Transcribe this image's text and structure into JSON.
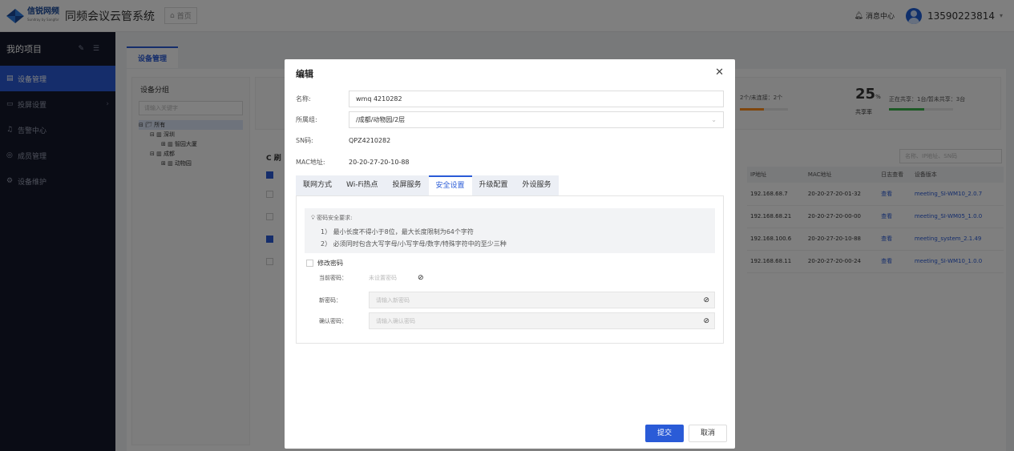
{
  "colors": {
    "primary": "#2a5bd7",
    "sidebar_bg": "#14182a",
    "overlay": "rgba(0,0,0,0.5)"
  },
  "header": {
    "brand_name": "信锐网频",
    "brand_sub": "Sundray by Sangfor",
    "app_title": "同频会议云管系统",
    "home_crumb": "首页",
    "message_center": "消息中心",
    "username": "13590223814"
  },
  "sidebar": {
    "title": "我的项目",
    "items": [
      {
        "label": "设备管理",
        "icon": "device-icon"
      },
      {
        "label": "投屏设置",
        "icon": "screen-icon"
      },
      {
        "label": "告警中心",
        "icon": "bell-icon"
      },
      {
        "label": "成员管理",
        "icon": "user-icon"
      },
      {
        "label": "设备维护",
        "icon": "wrench-icon"
      }
    ]
  },
  "main": {
    "tab": "设备管理",
    "group_panel": {
      "title": "设备分组",
      "search_placeholder": "请输入关键字",
      "tree": [
        "所有",
        "深圳",
        "智园大厦",
        "成都",
        "动物园"
      ]
    },
    "stats": {
      "connection": "2个/未连接：2个",
      "share_value": "25",
      "share_unit": "%",
      "share_label": "共享率",
      "share_detail": "正在共享：1台/暂未共享：3台"
    },
    "refresh_label": "C 刷",
    "table_search_placeholder": "名称、IP地址、SN码",
    "table": {
      "headers": [
        "IP地址",
        "MAC地址",
        "日志查看",
        "设备版本"
      ],
      "rows": [
        [
          "192.168.68.7",
          "20-20-27-20-01-32",
          "查看",
          "meeting_SI-WM10_2.0.7"
        ],
        [
          "192.168.68.21",
          "20-20-27-20-00-00",
          "查看",
          "meeting_SI-WM05_1.0.0"
        ],
        [
          "192.168.100.6",
          "20-20-27-20-10-88",
          "查看",
          "meeting_system_2.1.49"
        ],
        [
          "192.168.68.11",
          "20-20-27-20-00-24",
          "查看",
          "meeting_SI-WM10_1.0.0"
        ]
      ]
    }
  },
  "modal": {
    "title": "编辑",
    "name_label": "名称:",
    "name_value": "wmq 4210282",
    "group_label": "所属组:",
    "group_value": "/成都/动物园/2层",
    "sn_label": "SN码:",
    "sn_value": "QPZ4210282",
    "mac_label": "MAC地址:",
    "mac_value": "20-20-27-20-10-88",
    "tabs": [
      "联网方式",
      "Wi-Fi热点",
      "投屏服务",
      "安全设置",
      "升级配置",
      "外设服务"
    ],
    "active_tab": "安全设置",
    "tip_head": "密码安全要求:",
    "tip_line1": "1）  最小长度不得小于8位，最大长度限制为64个字符",
    "tip_line2": "2）  必须同时包含大写字母/小写字母/数字/特殊字符中的至少三种",
    "change_pw_label": "修改密码",
    "current_pw_label": "当前密码：",
    "current_pw_value": "未设置密码",
    "new_pw_label": "新密码：",
    "new_pw_placeholder": "请输入新密码",
    "confirm_pw_label": "确认密码：",
    "confirm_pw_placeholder": "请输入确认密码",
    "submit": "提交",
    "cancel": "取消"
  }
}
